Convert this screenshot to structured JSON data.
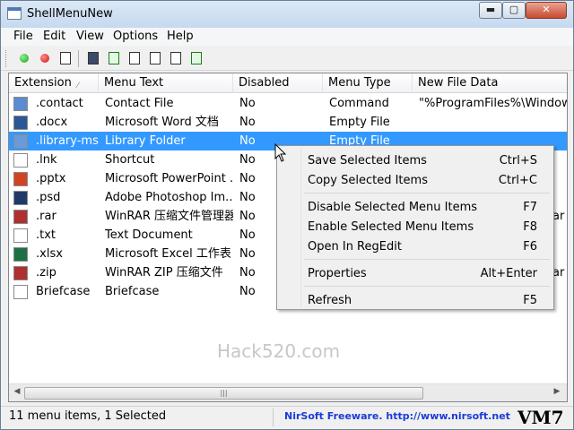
{
  "window": {
    "title": "ShellMenuNew",
    "controls": {
      "minimize": "▬",
      "maximize": "▢",
      "close": "✕"
    }
  },
  "menubar": [
    "File",
    "Edit",
    "View",
    "Options",
    "Help"
  ],
  "toolbar": {
    "buttons": [
      "enable-green-icon",
      "disable-red-icon",
      "properties-icon",
      "save-icon",
      "refresh-icon",
      "copy-icon",
      "html-report-icon",
      "find-icon",
      "exit-icon"
    ]
  },
  "columns": [
    "Extension",
    "Menu Text",
    "Disabled",
    "Menu Type",
    "New File Data"
  ],
  "rows": [
    {
      "ext": ".contact",
      "text": "Contact File",
      "disabled": "No",
      "type": "Command",
      "data": "\"%ProgramFiles%\\Windows",
      "icon_color": "#5b8bd1"
    },
    {
      "ext": ".docx",
      "text": "Microsoft Word 文档",
      "disabled": "No",
      "type": "Empty File",
      "data": "",
      "icon_color": "#2b5797"
    },
    {
      "ext": ".library-ms",
      "text": "Library Folder",
      "disabled": "No",
      "type": "Empty File",
      "data": "",
      "icon_color": "#6a9bd8"
    },
    {
      "ext": ".lnk",
      "text": "Shortcut",
      "disabled": "No",
      "type": "",
      "data": "",
      "icon_color": "#ffffff"
    },
    {
      "ext": ".pptx",
      "text": "Microsoft PowerPoint ...",
      "disabled": "No",
      "type": "",
      "data": "",
      "icon_color": "#d04423"
    },
    {
      "ext": ".psd",
      "text": "Adobe Photoshop Im...",
      "disabled": "No",
      "type": "",
      "data": "",
      "icon_color": "#1f3a66"
    },
    {
      "ext": ".rar",
      "text": "WinRAR 压缩文件管理器",
      "disabled": "No",
      "type": "",
      "data": "ar",
      "icon_color": "#b03030"
    },
    {
      "ext": ".txt",
      "text": "Text Document",
      "disabled": "No",
      "type": "",
      "data": "",
      "icon_color": "#ffffff"
    },
    {
      "ext": ".xlsx",
      "text": "Microsoft Excel 工作表",
      "disabled": "No",
      "type": "",
      "data": "",
      "icon_color": "#1e7145"
    },
    {
      "ext": ".zip",
      "text": "WinRAR ZIP 压缩文件",
      "disabled": "No",
      "type": "",
      "data": "ar",
      "icon_color": "#b03030"
    },
    {
      "ext": "Briefcase",
      "text": "Briefcase",
      "disabled": "No",
      "type": "",
      "data": "",
      "icon_color": "#ffffff"
    }
  ],
  "selected_row": 2,
  "context_menu": [
    {
      "label": "Save Selected Items",
      "shortcut": "Ctrl+S"
    },
    {
      "label": "Copy Selected Items",
      "shortcut": "Ctrl+C"
    },
    {
      "label": "Disable Selected Menu Items",
      "shortcut": "F7"
    },
    {
      "label": "Enable Selected Menu Items",
      "shortcut": "F8"
    },
    {
      "label": "Open In RegEdit",
      "shortcut": "F6"
    },
    {
      "label": "Properties",
      "shortcut": "Alt+Enter"
    },
    {
      "label": "Refresh",
      "shortcut": "F5"
    }
  ],
  "watermark": "Hack520.com",
  "status": {
    "count": "11 menu items, 1 Selected",
    "link": "NirSoft Freeware.  http://www.nirsoft.net",
    "badge": "VM7"
  },
  "colors": {
    "selection": "#3399ff",
    "link": "#1a3cd8"
  }
}
